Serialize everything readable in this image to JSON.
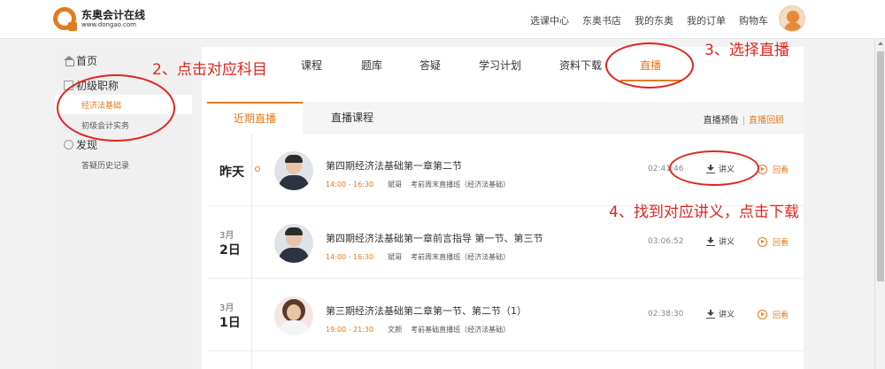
{
  "header": {
    "logo_cn": "东奥会计在线",
    "logo_url": "www.dongao.com",
    "nav": [
      "选课中心",
      "东奥书店",
      "我的东奥",
      "我的订单",
      "购物车"
    ]
  },
  "sidebar": {
    "home": "首页",
    "section_title": "初级职称",
    "subjects": [
      "经济法基础",
      "初级会计实务"
    ],
    "discover": "发现",
    "discover_items": [
      "答疑历史记录"
    ]
  },
  "main": {
    "tabs": [
      "课程",
      "题库",
      "答疑",
      "学习计划",
      "资料下载",
      "直播"
    ],
    "active_tab": "直播",
    "subtabs": [
      "近期直播",
      "直播课程"
    ],
    "right_links": [
      "直播预告",
      "直播回顾"
    ],
    "rows": [
      {
        "date_big": "昨天",
        "date_month": "",
        "title": "第四期经济法基础第一章第二节",
        "time": "14:00 - 16:30",
        "teacher": "斌哥",
        "course": "考前周末直播班（经济法基础）",
        "duration": "02:41:46",
        "handout": "讲义",
        "replay": "回看"
      },
      {
        "date_big": "2日",
        "date_month": "3月",
        "title": "第四期经济法基础第一章前言指导 第一节、第三节",
        "time": "14:00 - 16:30",
        "teacher": "斌哥",
        "course": "考前周末直播班（经济法基础）",
        "duration": "03:06:52",
        "handout": "讲义",
        "replay": "回看"
      },
      {
        "date_big": "1日",
        "date_month": "3月",
        "title": "第三期经济法基础第二章第一节、第二节（1）",
        "time": "19:00 - 21:30",
        "teacher": "文颜",
        "course": "考前基础直播班（经济法基础）",
        "duration": "02:38:30",
        "handout": "讲义",
        "replay": "回看"
      }
    ]
  },
  "annotations": {
    "step2": "2、点击对应科目",
    "step3": "3、选择直播",
    "step4": "4、找到对应讲义，点击下载",
    "color": "#e0251e"
  },
  "colors": {
    "accent": "#e47a1c"
  }
}
